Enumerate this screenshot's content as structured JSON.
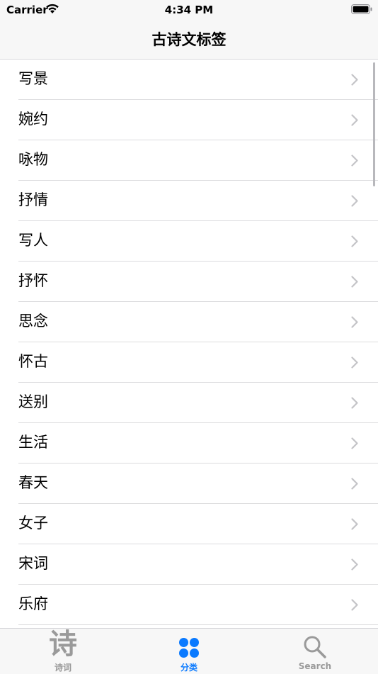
{
  "status": {
    "carrier": "Carrier",
    "time": "4:34 PM"
  },
  "nav": {
    "title": "古诗文标签"
  },
  "items": [
    {
      "label": "写景"
    },
    {
      "label": "婉约"
    },
    {
      "label": "咏物"
    },
    {
      "label": "抒情"
    },
    {
      "label": "写人"
    },
    {
      "label": "抒怀"
    },
    {
      "label": "思念"
    },
    {
      "label": "怀古"
    },
    {
      "label": "送别"
    },
    {
      "label": "生活"
    },
    {
      "label": "春天"
    },
    {
      "label": "女子"
    },
    {
      "label": "宋词"
    },
    {
      "label": "乐府"
    },
    {
      "label": ""
    }
  ],
  "tabs": [
    {
      "label": "诗词",
      "icon": "poem-glyph-icon",
      "glyph": "诗",
      "selected": false
    },
    {
      "label": "分类",
      "icon": "four-dots-grid-icon",
      "selected": true
    },
    {
      "label": "Search",
      "icon": "magnifier-icon",
      "selected": false
    }
  ],
  "colors": {
    "accent": "#0a7aff",
    "inactive": "#9a9a9a",
    "chevron": "#c4c4c7",
    "bar_background": "#f7f7f7"
  }
}
